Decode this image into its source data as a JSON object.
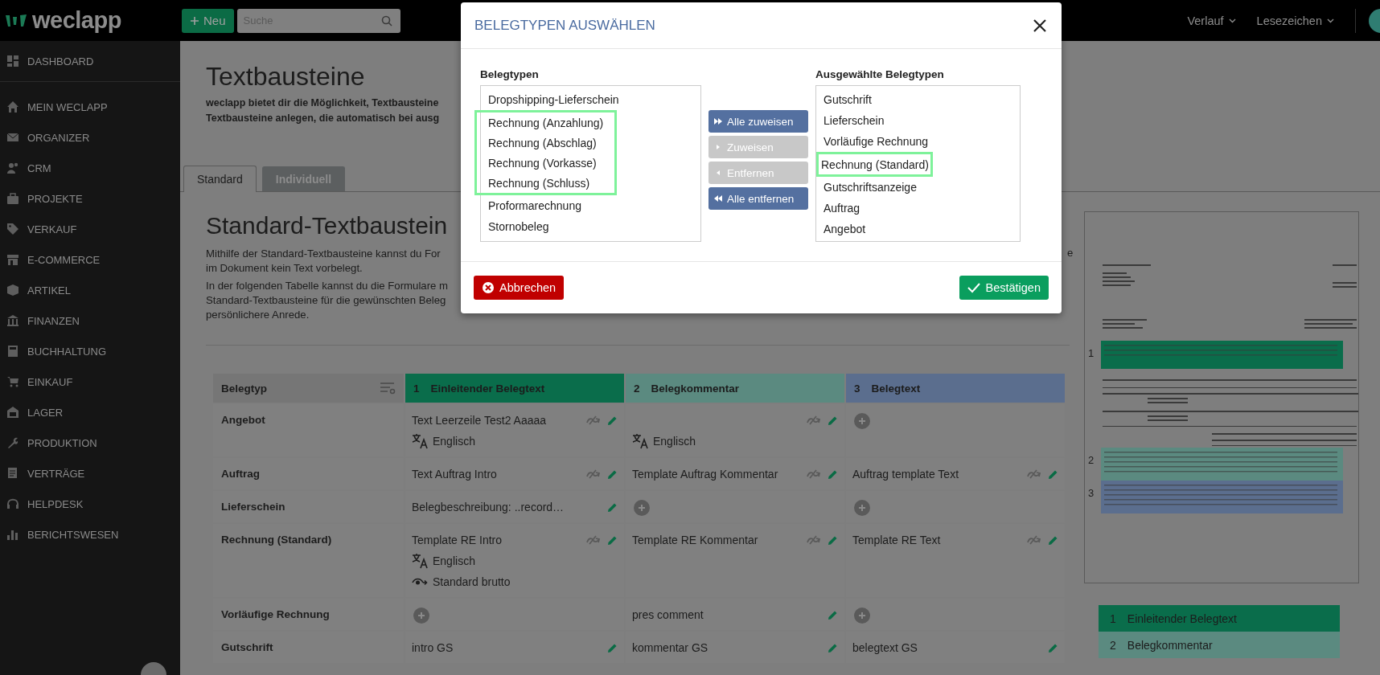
{
  "header": {
    "logo": "weclapp",
    "new_button": "Neu",
    "search": {
      "placeholder": "Suche"
    },
    "menus": [
      "Verlauf",
      "Lesezeichen"
    ]
  },
  "sidebar": {
    "items": [
      {
        "label": "DASHBOARD"
      },
      {
        "label": "MEIN WECLAPP"
      },
      {
        "label": "ORGANIZER"
      },
      {
        "label": "CRM"
      },
      {
        "label": "PROJEKTE"
      },
      {
        "label": "VERKAUF"
      },
      {
        "label": "E-COMMERCE"
      },
      {
        "label": "ARTIKEL"
      },
      {
        "label": "FINANZEN"
      },
      {
        "label": "BUCHHALTUNG"
      },
      {
        "label": "EINKAUF"
      },
      {
        "label": "LAGER"
      },
      {
        "label": "PRODUKTION"
      },
      {
        "label": "VERTRÄGE"
      },
      {
        "label": "HELPDESK"
      },
      {
        "label": "BERICHTSWESEN"
      }
    ]
  },
  "page": {
    "title": "Textbausteine",
    "intro_lines": [
      "weclapp bietet dir die Möglichkeit, Textbausteine",
      "Textbausteine anlegen, die automatisch bei ausg"
    ],
    "tabs": [
      {
        "label": "Standard",
        "selected": true
      },
      {
        "label": "Individuell",
        "selected": false
      }
    ],
    "section_title": "Standard-Textbaustein",
    "paragraphs": [
      [
        "Mithilfe der Standard-Textbausteine kannst du For",
        "im Dokument kein Text vorbelegt."
      ],
      [
        "In der folgenden Tabelle kannst du die Formulare m",
        "Standard-Textbausteine für die gewünschten Beleg",
        "persönlichere Anrede."
      ]
    ],
    "line_fragment": "e"
  },
  "table": {
    "columns": [
      {
        "label": "Belegtyp"
      },
      {
        "number": "1",
        "label": "Einleitender Belegtext",
        "color": "#0a6d4b"
      },
      {
        "number": "2",
        "label": "Belegkommentar",
        "color": "#5b8a80"
      },
      {
        "number": "3",
        "label": "Belegtext",
        "color": "#5b6e8e"
      }
    ],
    "rows": [
      {
        "cells": [
          {
            "kind": "label",
            "text": "Angebot"
          },
          {
            "kind": "text",
            "text": "Text Leerzeile Test2 Aaaaa",
            "linked": true,
            "details": [
              {
                "kind": "language",
                "text": "Englisch"
              }
            ]
          },
          {
            "kind": "text",
            "linked": true,
            "details": [
              {
                "kind": "language",
                "text": "Englisch"
              }
            ]
          },
          {
            "kind": "add"
          }
        ]
      },
      {
        "cells": [
          {
            "kind": "label",
            "text": "Auftrag"
          },
          {
            "kind": "text",
            "text": "Text Auftrag Intro",
            "linked": true
          },
          {
            "kind": "text",
            "text": "Template Auftrag Kommentar",
            "linked": true
          },
          {
            "kind": "text",
            "text": "Auftrag template Text",
            "linked": true
          }
        ]
      },
      {
        "cells": [
          {
            "kind": "label",
            "text": "Lieferschein"
          },
          {
            "kind": "text",
            "text": "Belegbeschreibung: ..record…",
            "linked": false
          },
          {
            "kind": "add"
          },
          {
            "kind": "add"
          }
        ]
      },
      {
        "cells": [
          {
            "kind": "label",
            "text": "Rechnung (Standard)"
          },
          {
            "kind": "text",
            "text": "Template RE Intro",
            "linked": true,
            "details": [
              {
                "kind": "language",
                "text": "Englisch"
              },
              {
                "kind": "price_mode",
                "text": "Standard brutto"
              }
            ]
          },
          {
            "kind": "text",
            "text": "Template RE Kommentar",
            "linked": true
          },
          {
            "kind": "text",
            "text": "Template RE Text",
            "linked": true
          }
        ]
      },
      {
        "cells": [
          {
            "kind": "label",
            "text": "Vorläufige Rechnung"
          },
          {
            "kind": "add"
          },
          {
            "kind": "text",
            "text": "pres comment",
            "linked": false
          },
          {
            "kind": "add"
          }
        ]
      },
      {
        "cells": [
          {
            "kind": "label",
            "text": "Gutschrift"
          },
          {
            "kind": "text",
            "text": "intro GS",
            "linked": false
          },
          {
            "kind": "text",
            "text": "kommentar GS",
            "linked": false
          },
          {
            "kind": "text",
            "text": "belegtext GS",
            "linked": false
          }
        ]
      }
    ]
  },
  "preview": {
    "markers": [
      "1",
      "2",
      "3"
    ],
    "legend": [
      {
        "number": "1",
        "label": "Einleitender Belegtext",
        "color": "#0a6d4b"
      },
      {
        "number": "2",
        "label": "Belegkommentar",
        "color": "#5b8a80"
      }
    ]
  },
  "dialog": {
    "title": "BELEGTYPEN AUSWÄHLEN",
    "available": {
      "label": "Belegtypen",
      "items": [
        {
          "label": "Dropshipping-Lieferschein",
          "highlighted": false
        },
        {
          "label": "Rechnung (Anzahlung)",
          "highlighted": true
        },
        {
          "label": "Rechnung (Abschlag)",
          "highlighted": true
        },
        {
          "label": "Rechnung (Vorkasse)",
          "highlighted": true
        },
        {
          "label": "Rechnung (Schluss)",
          "highlighted": true
        },
        {
          "label": "Proformarechnung",
          "highlighted": false
        },
        {
          "label": "Stornobeleg",
          "highlighted": false
        }
      ]
    },
    "transfer_buttons": [
      {
        "label": "Alle zuweisen",
        "disabled": false
      },
      {
        "label": "Zuweisen",
        "disabled": true
      },
      {
        "label": "Entfernen",
        "disabled": true
      },
      {
        "label": "Alle entfernen",
        "disabled": false
      }
    ],
    "selected": {
      "label": "Ausgewählte Belegtypen",
      "items": [
        {
          "label": "Gutschrift",
          "highlighted": false
        },
        {
          "label": "Lieferschein",
          "highlighted": false
        },
        {
          "label": "Vorläufige Rechnung",
          "highlighted": false
        },
        {
          "label": "Rechnung (Standard)",
          "highlighted": true
        },
        {
          "label": "Gutschriftsanzeige",
          "highlighted": false
        },
        {
          "label": "Auftrag",
          "highlighted": false
        },
        {
          "label": "Angebot",
          "highlighted": false
        }
      ]
    },
    "cancel_button": "Abbrechen",
    "confirm_button": "Bestätigen"
  }
}
